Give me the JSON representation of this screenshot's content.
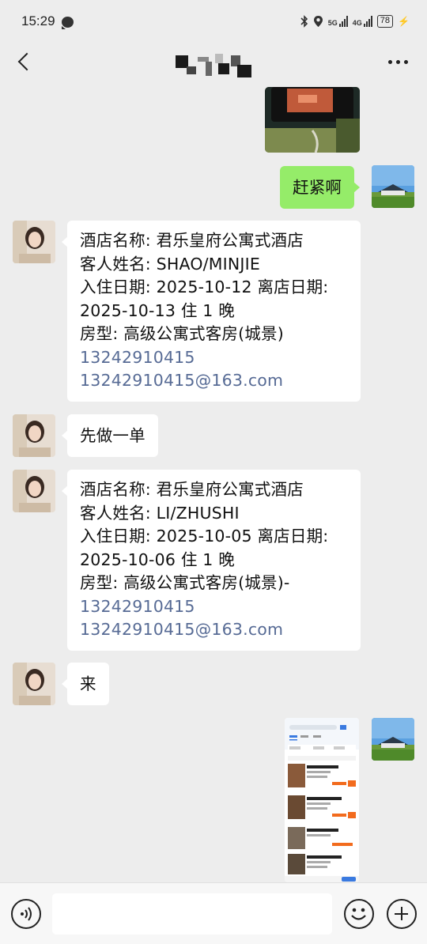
{
  "status_bar": {
    "time": "15:29",
    "icons": [
      "chat-notification-icon",
      "bluetooth-icon",
      "location-icon",
      "signal-5g-icon",
      "signal-4g-icon"
    ],
    "network_5g": "5G",
    "network_4g": "4G",
    "battery": "78"
  },
  "header": {
    "title_redacted": true,
    "back_icon": "back-chevron-icon",
    "more_icon": "more-dots-icon"
  },
  "messages": [
    {
      "side": "right",
      "type": "image",
      "description": "phone-photo-thumbnail"
    },
    {
      "side": "right",
      "type": "text",
      "text": "赶紧啊"
    },
    {
      "side": "left",
      "type": "text",
      "lines": [
        "酒店名称: 君乐皇府公寓式酒店",
        "客人姓名: SHAO/MINJIE",
        "入住日期: 2025-10-12 离店日期:",
        "2025-10-13 住 1 晚",
        "房型: 高级公寓式客房(城景)"
      ],
      "phone": "13242910415",
      "email": "13242910415@163.com"
    },
    {
      "side": "left",
      "type": "text",
      "text": "先做一单"
    },
    {
      "side": "left",
      "type": "text",
      "lines": [
        "酒店名称: 君乐皇府公寓式酒店",
        "客人姓名: LI/ZHUSHI",
        "入住日期: 2025-10-05 离店日期:",
        "2025-10-06 住 1 晚",
        "房型: 高级公寓式客房(城景)-"
      ],
      "phone": "13242910415",
      "email": "13242910415@163.com"
    },
    {
      "side": "left",
      "type": "text",
      "text": "来"
    },
    {
      "side": "right",
      "type": "image",
      "description": "hotel-booking-app-screenshot"
    }
  ],
  "input_bar": {
    "voice_icon": "voice-icon",
    "emoji_icon": "emoji-icon",
    "plus_icon": "plus-icon",
    "input_value": ""
  },
  "colors": {
    "background": "#ededed",
    "sent_bubble": "#95ec69",
    "received_bubble": "#ffffff",
    "link": "#576b95"
  }
}
